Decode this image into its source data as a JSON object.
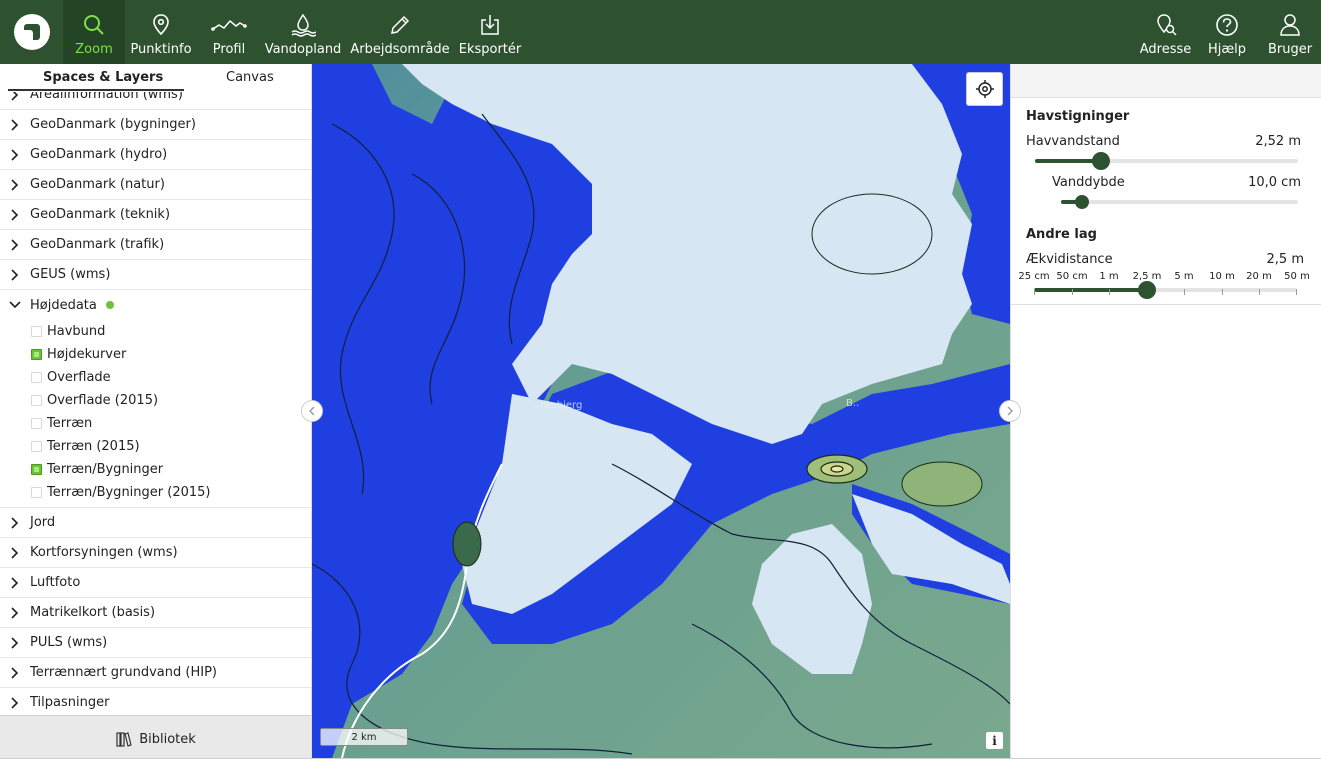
{
  "toolbar": {
    "items": [
      {
        "label": "Zoom",
        "icon": "search-icon"
      },
      {
        "label": "Punktinfo",
        "icon": "map-pin-icon"
      },
      {
        "label": "Profil",
        "icon": "profile-line-icon"
      },
      {
        "label": "Vandopland",
        "icon": "water-drop-icon"
      },
      {
        "label": "Arbejdsområde",
        "icon": "pencil-icon"
      },
      {
        "label": "Eksportér",
        "icon": "export-icon"
      },
      {
        "label": "Adresse",
        "icon": "address-search-icon"
      },
      {
        "label": "Hjælp",
        "icon": "help-icon"
      },
      {
        "label": "Bruger",
        "icon": "user-icon"
      }
    ],
    "active": "Zoom",
    "colors": {
      "bar": "#2e5230",
      "active_label": "#7ee04a"
    }
  },
  "left_panel": {
    "tabs": [
      "Spaces & Layers",
      "Canvas"
    ],
    "layers_top": [
      "Arealinformation (wms)",
      "GeoDanmark (bygninger)",
      "GeoDanmark (hydro)",
      "GeoDanmark (natur)",
      "GeoDanmark (teknik)",
      "GeoDanmark (trafik)",
      "GEUS (wms)"
    ],
    "expanded_group": {
      "label": "Højdedata",
      "status_color": "#6cc23a",
      "items": [
        {
          "label": "Havbund",
          "checked": false
        },
        {
          "label": "Højdekurver",
          "checked": true
        },
        {
          "label": "Overflade",
          "checked": false
        },
        {
          "label": "Overflade (2015)",
          "checked": false
        },
        {
          "label": "Terræn",
          "checked": false
        },
        {
          "label": "Terræn (2015)",
          "checked": false
        },
        {
          "label": "Terræn/Bygninger",
          "checked": true
        },
        {
          "label": "Terræn/Bygninger (2015)",
          "checked": false
        }
      ]
    },
    "layers_bottom": [
      "Jord",
      "Kortforsyningen (wms)",
      "Luftfoto",
      "Matrikelkort (basis)",
      "PULS (wms)",
      "Terrænnært grundvand (HIP)",
      "Tilpasninger"
    ],
    "library_button": "Bibliotek"
  },
  "map": {
    "scale_label": "2 km",
    "info_label": "i",
    "place_labels": [
      "..ntebjerg",
      "B.."
    ],
    "colors": {
      "land": "#6f9f92",
      "flood": "#1f3fe0",
      "sea": "#d6e6f2",
      "contour": "#1a2a1a"
    }
  },
  "right_panel": {
    "sea_rise": {
      "title": "Havstigninger",
      "sea_level_label": "Havvandstand",
      "sea_level_value": "2,52 m",
      "sea_level_fraction": 0.25,
      "depth_label": "Vanddybde",
      "depth_value": "10,0 cm",
      "depth_fraction": 0.1
    },
    "other_layers": {
      "title": "Andre lag",
      "contour_label": "Ækvidistance",
      "contour_value": "2,5 m",
      "ticks": [
        "25 cm",
        "50 cm",
        "1 m",
        "2,5 m",
        "5 m",
        "10 m",
        "20 m",
        "50 m"
      ],
      "selected_index": 3
    }
  }
}
